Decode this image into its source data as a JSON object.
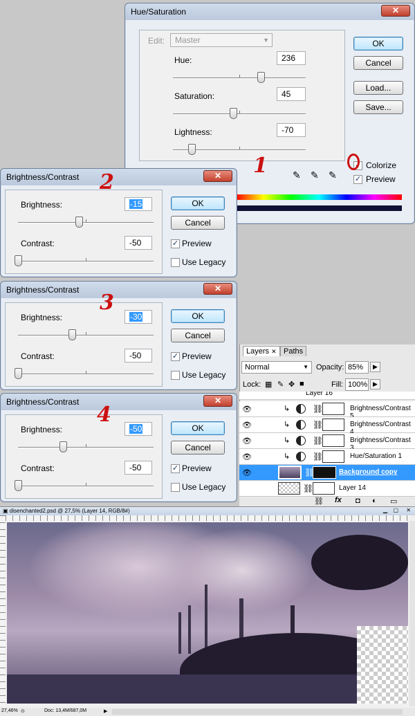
{
  "hue_sat": {
    "title": "Hue/Saturation",
    "edit_label": "Edit:",
    "edit_value": "Master",
    "hue_label": "Hue:",
    "hue_value": "236",
    "saturation_label": "Saturation:",
    "saturation_value": "45",
    "lightness_label": "Lightness:",
    "lightness_value": "-70",
    "ok": "OK",
    "cancel": "Cancel",
    "load": "Load...",
    "save": "Save...",
    "colorize_label": "Colorize",
    "preview_label": "Preview",
    "colorize_checked": true,
    "preview_checked": true
  },
  "bc_dialogs": [
    {
      "title": "Brightness/Contrast",
      "brightness_label": "Brightness:",
      "brightness_value": "-15",
      "contrast_label": "Contrast:",
      "contrast_value": "-50",
      "ok": "OK",
      "cancel": "Cancel",
      "preview_label": "Preview",
      "legacy_label": "Use Legacy",
      "brightness_level": -15,
      "contrast_level": -50
    },
    {
      "title": "Brightness/Contrast",
      "brightness_label": "Brightness:",
      "brightness_value": "-30",
      "contrast_label": "Contrast:",
      "contrast_value": "-50",
      "ok": "OK",
      "cancel": "Cancel",
      "preview_label": "Preview",
      "legacy_label": "Use Legacy",
      "brightness_level": -30,
      "contrast_level": -50
    },
    {
      "title": "Brightness/Contrast",
      "brightness_label": "Brightness:",
      "brightness_value": "-50",
      "contrast_label": "Contrast:",
      "contrast_value": "-50",
      "ok": "OK",
      "cancel": "Cancel",
      "preview_label": "Preview",
      "legacy_label": "Use Legacy",
      "brightness_level": -50,
      "contrast_level": -50
    }
  ],
  "annotations": [
    "1",
    "2",
    "3",
    "4"
  ],
  "layers_panel": {
    "tabs": [
      "Layers",
      "Paths"
    ],
    "blend_mode": "Normal",
    "opacity_label": "Opacity:",
    "opacity_value": "85%",
    "lock_label": "Lock:",
    "fill_label": "Fill:",
    "fill_value": "100%",
    "layers": [
      {
        "name": "Layer 16"
      },
      {
        "name": "Brightness/Contrast 5"
      },
      {
        "name": "Brightness/Contrast 4"
      },
      {
        "name": "Brightness/Contrast 3"
      },
      {
        "name": "Hue/Saturation 1"
      },
      {
        "name": "Background copy"
      },
      {
        "name": "Layer 14"
      }
    ]
  },
  "document": {
    "title": "disenchanted2.psd @ 27,5% (Layer 14, RGB/8#)",
    "zoom": "27,46%",
    "doc_info": "Doc: 13,4M/687,0M"
  },
  "colors": {
    "accent_blue": "#3399ff",
    "annotation_red": "#cc1010",
    "dialog_bg": "#e9eef5"
  }
}
